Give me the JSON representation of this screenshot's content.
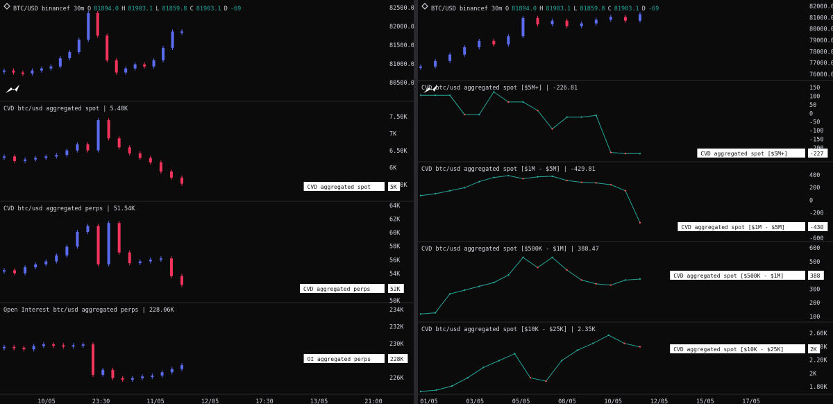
{
  "left": {
    "header": {
      "symbol": "BTC/USD binancef 30m",
      "o_label": "O",
      "o": "81894.0",
      "h_label": "H",
      "h": "81903.1",
      "l_label": "L",
      "l": "81859.8",
      "c_label": "C",
      "c": "81903.1",
      "d_label": "D",
      "d": "-69"
    },
    "x_ticks": [
      "10/05",
      "23:30",
      "11/05",
      "12/05",
      "17:30",
      "13/05",
      "21:00"
    ],
    "panes": [
      {
        "title": "",
        "ticks": [
          "82500.0",
          "82000.0",
          "81500.0",
          "81000.0",
          "80500.0"
        ],
        "label": "",
        "value": ""
      },
      {
        "title": "CVD btc/usd aggregated spot | 5.40K",
        "ticks": [
          "7.50K",
          "7K",
          "6.50K",
          "6K",
          "5.50K"
        ],
        "label": "CVD aggregated spot",
        "value": "5K"
      },
      {
        "title": "CVD btc/usd aggregated perps | 51.54K",
        "ticks": [
          "64K",
          "62K",
          "60K",
          "58K",
          "56K",
          "54K",
          "52K",
          "50K"
        ],
        "label": "CVD aggregated perps",
        "value": "52K"
      },
      {
        "title": "Open Interest btc/usd aggregated perps | 228.06K",
        "ticks": [
          "234K",
          "232K",
          "230K",
          "228K",
          "226K"
        ],
        "label": "OI aggregated perps",
        "value": "228K"
      }
    ]
  },
  "right": {
    "header": {
      "symbol": "BTC/USD binancef 30m",
      "o_label": "O",
      "o": "81894.0",
      "h_label": "H",
      "h": "81903.1",
      "l_label": "L",
      "l": "81859.8",
      "c_label": "C",
      "c": "81903.1",
      "d_label": "D",
      "d": "-69"
    },
    "x_ticks": [
      "01/05",
      "03/05",
      "05/05",
      "08/05",
      "10/05",
      "12/05",
      "15/05",
      "17/05"
    ],
    "panes": [
      {
        "title": "",
        "ticks": [
          "82000.0",
          "81000.0",
          "80000.0",
          "79000.0",
          "78000.0",
          "77000.0",
          "76000.0"
        ],
        "label": "",
        "value": ""
      },
      {
        "title": "CVD btc/usd aggregated spot [$5M+] | -226.81",
        "ticks": [
          "150",
          "100",
          "50",
          "0",
          "-50",
          "-100",
          "-150",
          "-200"
        ],
        "label": "CVD aggregated spot [$5M+]",
        "value": "-227"
      },
      {
        "title": "CVD btc/usd aggregated spot [$1M - $5M] | -429.81",
        "ticks": [
          "400",
          "200",
          "0",
          "-200",
          "-400",
          "-600"
        ],
        "label": "CVD aggregated spot [$1M - $5M]",
        "value": "-430"
      },
      {
        "title": "CVD btc/usd aggregated spot [$500K - $1M] | 388.47",
        "ticks": [
          "600",
          "500",
          "400",
          "300",
          "200",
          "100"
        ],
        "label": "CVD aggregated spot [$500K - $1M]",
        "value": "388"
      },
      {
        "title": "CVD btc/usd aggregated spot [$10K - $25K] | 2.35K",
        "ticks": [
          "2.60K",
          "2.40K",
          "2.20K",
          "2K",
          "1.80K"
        ],
        "label": "CVD aggregated spot [$10K - $25K]",
        "value": "2K"
      }
    ]
  },
  "colors": {
    "up": "#5b6cf0",
    "down": "#f2345c",
    "line_up": "#26a69a",
    "line_down": "#ef5350",
    "bg": "#0b0b0c"
  },
  "chart_data": [
    {
      "type": "candlestick",
      "title": "BTC/USD binancef 30m",
      "ylim": [
        80300,
        82500
      ],
      "x": [
        "10/05",
        "23:30",
        "11/05"
      ],
      "values": [
        80950,
        80900,
        80880,
        80950,
        81000,
        81050,
        81250,
        81400,
        81700,
        82350,
        81800,
        81200,
        80900,
        81000,
        81100,
        81050,
        81200,
        81500,
        81900,
        81903
      ]
    },
    {
      "type": "candlestick",
      "title": "CVD btc/usd aggregated spot | 5.40K",
      "ylim": [
        5000,
        7800
      ],
      "values": [
        6300,
        6150,
        6200,
        6250,
        6300,
        6350,
        6500,
        6700,
        6500,
        7500,
        6900,
        6600,
        6400,
        6250,
        6100,
        5800,
        5600,
        5400
      ]
    },
    {
      "type": "candlestick",
      "title": "CVD btc/usd aggregated perps | 51.54K",
      "ylim": [
        49800,
        64500
      ],
      "values": [
        54000,
        53500,
        54500,
        55000,
        55500,
        56500,
        58000,
        60500,
        61500,
        55000,
        62000,
        57000,
        55200,
        55500,
        55800,
        56000,
        53000,
        51540
      ]
    },
    {
      "type": "candlestick",
      "title": "Open Interest btc/usd aggregated perps | 228.06K",
      "ylim": [
        225200,
        234500
      ],
      "values": [
        230300,
        230200,
        230000,
        230400,
        230600,
        230500,
        230400,
        230500,
        230600,
        226900,
        227500,
        226500,
        226300,
        226500,
        226700,
        226800,
        227200,
        227600,
        228060
      ]
    },
    {
      "type": "candlestick",
      "title": "BTC/USD binancef 30m",
      "ylim": [
        75500,
        82700
      ],
      "x": [
        "01/05",
        "03/05",
        "05/05",
        "08/05",
        "10/05",
        "12/05",
        "15/05",
        "17/05"
      ],
      "values": [
        76200,
        76800,
        77500,
        78300,
        79000,
        78600,
        79500,
        81500,
        80800,
        81200,
        80600,
        80900,
        81300,
        81600,
        81200,
        81903
      ]
    },
    {
      "type": "line",
      "title": "CVD btc/usd aggregated spot [$5M+] | -226.81",
      "ylim": [
        -230,
        150
      ],
      "values": [
        120,
        120,
        120,
        5,
        5,
        140,
        80,
        80,
        30,
        -80,
        -10,
        -10,
        0,
        -220,
        -227,
        -227
      ]
    },
    {
      "type": "line",
      "title": "CVD btc/usd aggregated spot [$1M - $5M] | -429.81",
      "ylim": [
        -650,
        500
      ],
      "values": [
        20,
        50,
        100,
        150,
        250,
        320,
        350,
        300,
        330,
        340,
        270,
        240,
        230,
        200,
        100,
        -430
      ]
    },
    {
      "type": "line",
      "title": "CVD btc/usd aggregated spot [$500K - $1M] | 388.47",
      "ylim": [
        90,
        620
      ],
      "values": [
        110,
        120,
        270,
        300,
        330,
        360,
        420,
        560,
        480,
        560,
        460,
        380,
        350,
        340,
        380,
        388
      ]
    },
    {
      "type": "line",
      "title": "CVD btc/usd aggregated spot [$10K - $25K] | 2.35K",
      "ylim": [
        1720,
        2650
      ],
      "values": [
        1700,
        1720,
        1780,
        1900,
        2050,
        2150,
        2250,
        1900,
        1850,
        2150,
        2300,
        2400,
        2520,
        2400,
        2350
      ]
    }
  ]
}
